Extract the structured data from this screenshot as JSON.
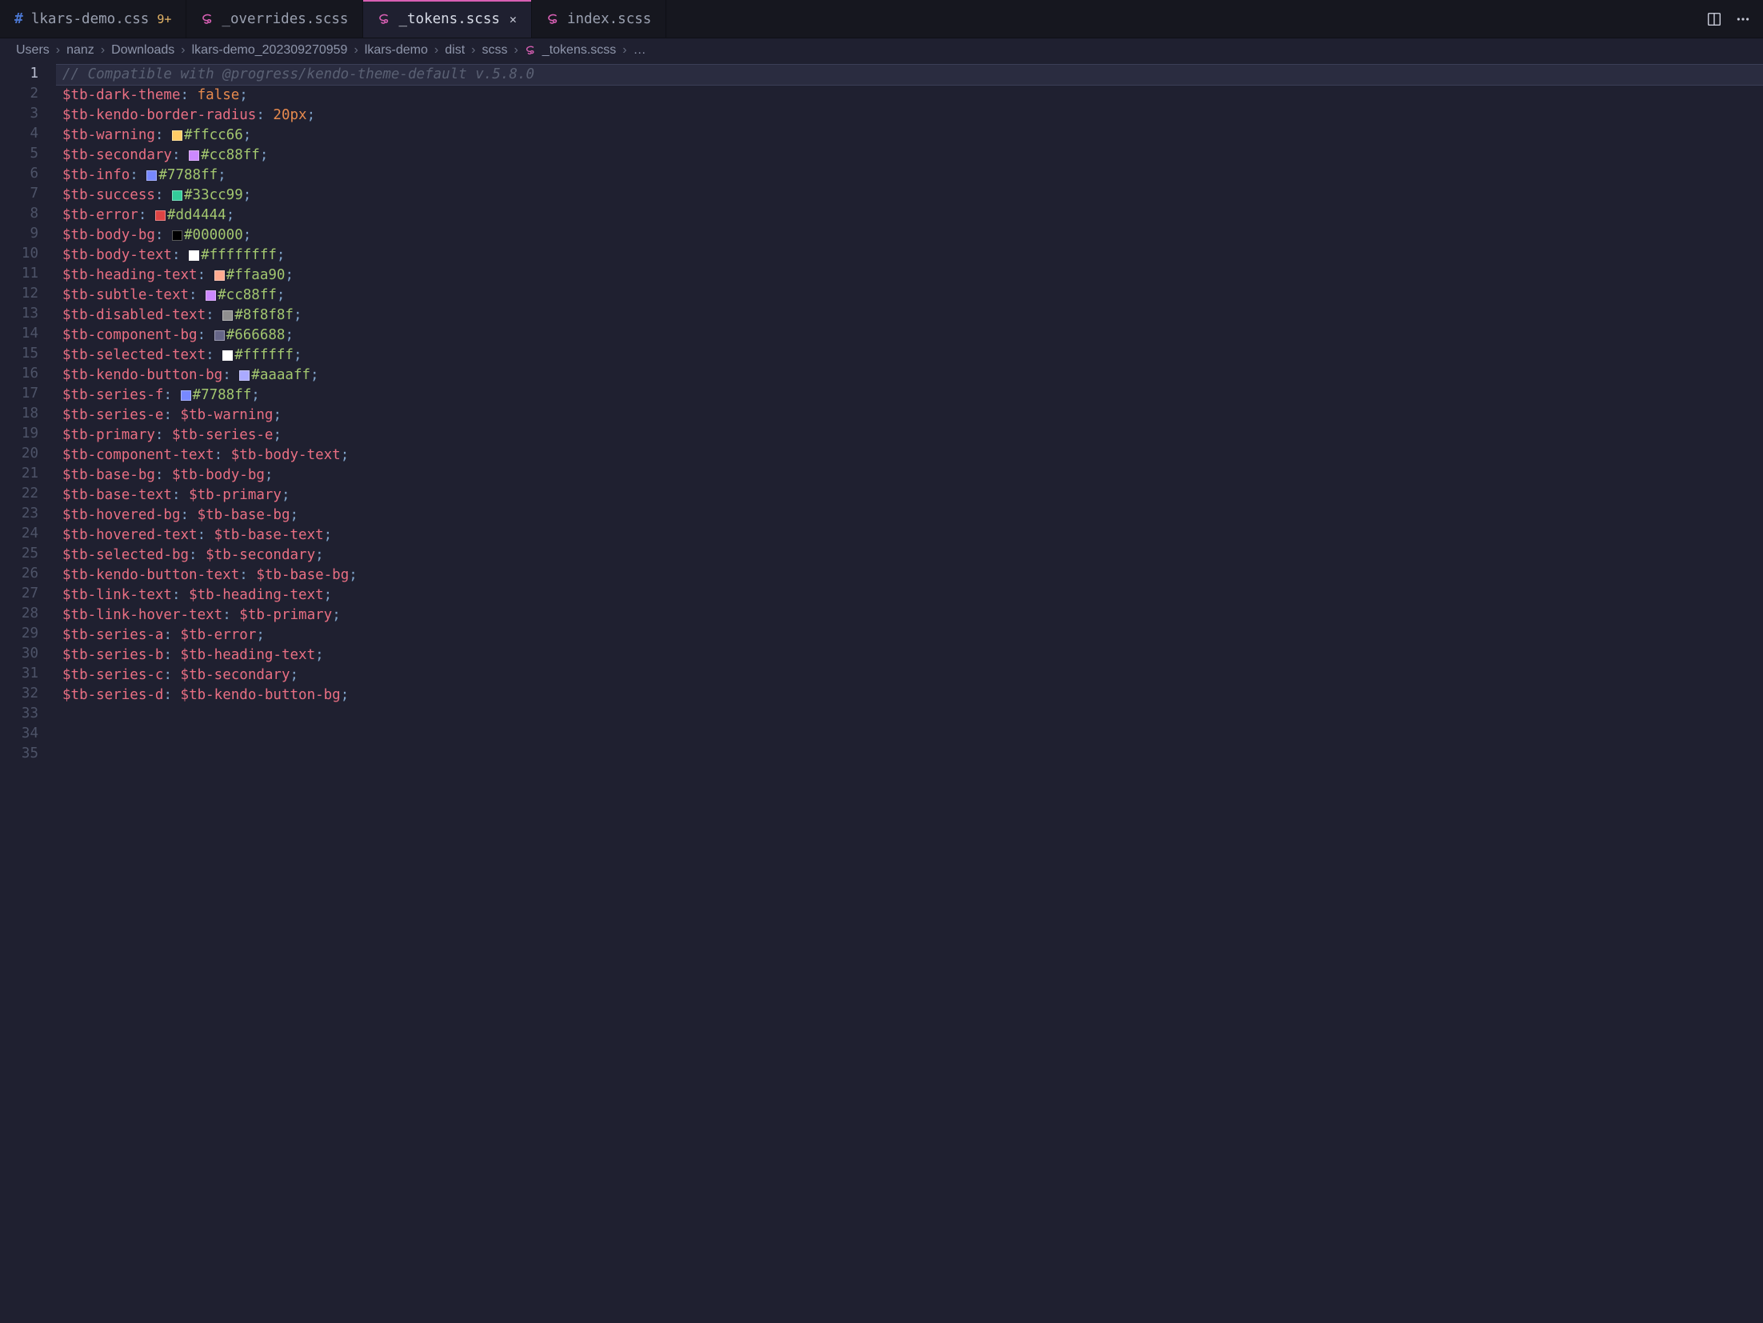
{
  "tabs": [
    {
      "icon": "css",
      "label": "lkars-demo.css",
      "badge": "9+",
      "active": false,
      "close": false
    },
    {
      "icon": "scss",
      "label": "_overrides.scss",
      "badge": "",
      "active": false,
      "close": false
    },
    {
      "icon": "scss",
      "label": "_tokens.scss",
      "badge": "",
      "active": true,
      "close": true
    },
    {
      "icon": "scss",
      "label": "index.scss",
      "badge": "",
      "active": false,
      "close": false
    }
  ],
  "breadcrumbs": {
    "segments": [
      "Users",
      "nanz",
      "Downloads",
      "lkars-demo_202309270959",
      "lkars-demo",
      "dist",
      "scss"
    ],
    "file": "_tokens.scss",
    "trailing": "…"
  },
  "code": {
    "current_line": 1,
    "lines": [
      {
        "type": "comment",
        "text": "// Compatible with @progress/kendo-theme-default v.5.8.0"
      },
      {
        "type": "blank"
      },
      {
        "type": "blank"
      },
      {
        "type": "assign",
        "var": "$tb-dark-theme",
        "value_kind": "kw",
        "value": "false"
      },
      {
        "type": "assign",
        "var": "$tb-kendo-border-radius",
        "value_kind": "num",
        "value": "20px"
      },
      {
        "type": "assign",
        "var": "$tb-warning",
        "value_kind": "color",
        "swatch": "#ffcc66",
        "value": "#ffcc66"
      },
      {
        "type": "assign",
        "var": "$tb-secondary",
        "value_kind": "color",
        "swatch": "#cc88ff",
        "value": "#cc88ff"
      },
      {
        "type": "assign",
        "var": "$tb-info",
        "value_kind": "color",
        "swatch": "#7788ff",
        "value": "#7788ff"
      },
      {
        "type": "assign",
        "var": "$tb-success",
        "value_kind": "color",
        "swatch": "#33cc99",
        "value": "#33cc99"
      },
      {
        "type": "assign",
        "var": "$tb-error",
        "value_kind": "color",
        "swatch": "#dd4444",
        "value": "#dd4444"
      },
      {
        "type": "assign",
        "var": "$tb-body-bg",
        "value_kind": "color",
        "swatch": "#000000",
        "value": "#000000"
      },
      {
        "type": "assign",
        "var": "$tb-body-text",
        "value_kind": "color",
        "swatch": "#ffffff",
        "value": "#ffffffff"
      },
      {
        "type": "assign",
        "var": "$tb-heading-text",
        "value_kind": "color",
        "swatch": "#ffaa90",
        "value": "#ffaa90"
      },
      {
        "type": "assign",
        "var": "$tb-subtle-text",
        "value_kind": "color",
        "swatch": "#cc88ff",
        "value": "#cc88ff"
      },
      {
        "type": "assign",
        "var": "$tb-disabled-text",
        "value_kind": "color",
        "swatch": "#8f8f8f",
        "value": "#8f8f8f"
      },
      {
        "type": "assign",
        "var": "$tb-component-bg",
        "value_kind": "color",
        "swatch": "#666688",
        "value": "#666688"
      },
      {
        "type": "assign",
        "var": "$tb-selected-text",
        "value_kind": "color",
        "swatch": "#ffffff",
        "value": "#ffffff"
      },
      {
        "type": "assign",
        "var": "$tb-kendo-button-bg",
        "value_kind": "color",
        "swatch": "#aaaaff",
        "value": "#aaaaff"
      },
      {
        "type": "assign",
        "var": "$tb-series-f",
        "value_kind": "color",
        "swatch": "#7788ff",
        "value": "#7788ff"
      },
      {
        "type": "assign",
        "var": "$tb-series-e",
        "value_kind": "var",
        "value": "$tb-warning"
      },
      {
        "type": "assign",
        "var": "$tb-primary",
        "value_kind": "var",
        "value": "$tb-series-e"
      },
      {
        "type": "assign",
        "var": "$tb-component-text",
        "value_kind": "var",
        "value": "$tb-body-text"
      },
      {
        "type": "assign",
        "var": "$tb-base-bg",
        "value_kind": "var",
        "value": "$tb-body-bg"
      },
      {
        "type": "assign",
        "var": "$tb-base-text",
        "value_kind": "var",
        "value": "$tb-primary"
      },
      {
        "type": "assign",
        "var": "$tb-hovered-bg",
        "value_kind": "var",
        "value": "$tb-base-bg"
      },
      {
        "type": "assign",
        "var": "$tb-hovered-text",
        "value_kind": "var",
        "value": "$tb-base-text"
      },
      {
        "type": "assign",
        "var": "$tb-selected-bg",
        "value_kind": "var",
        "value": "$tb-secondary"
      },
      {
        "type": "assign",
        "var": "$tb-kendo-button-text",
        "value_kind": "var",
        "value": "$tb-base-bg"
      },
      {
        "type": "assign",
        "var": "$tb-link-text",
        "value_kind": "var",
        "value": "$tb-heading-text"
      },
      {
        "type": "assign",
        "var": "$tb-link-hover-text",
        "value_kind": "var",
        "value": "$tb-primary"
      },
      {
        "type": "assign",
        "var": "$tb-series-a",
        "value_kind": "var",
        "value": "$tb-error"
      },
      {
        "type": "assign",
        "var": "$tb-series-b",
        "value_kind": "var",
        "value": "$tb-heading-text"
      },
      {
        "type": "assign",
        "var": "$tb-series-c",
        "value_kind": "var",
        "value": "$tb-secondary"
      },
      {
        "type": "assign",
        "var": "$tb-series-d",
        "value_kind": "var",
        "value": "$tb-kendo-button-bg"
      },
      {
        "type": "blank"
      }
    ]
  }
}
